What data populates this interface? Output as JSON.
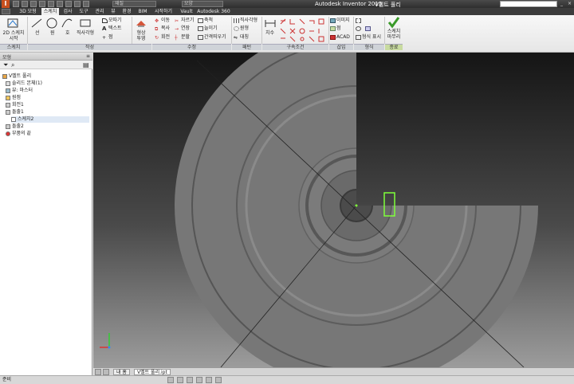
{
  "app": {
    "title": "Autodesk Inventor 2015",
    "document": "V벨트 풀리"
  },
  "quick_access": {
    "combo1": "재질",
    "combo2": "모양"
  },
  "tabs": [
    "3D 모형",
    "스케치",
    "검사",
    "도구",
    "관리",
    "뷰",
    "환경",
    "BIM",
    "시작하기",
    "Vault",
    "Autodesk 360"
  ],
  "active_tab": "스케치",
  "ribbon": {
    "sketch_2d": "2D 스케치\n시작",
    "line": "선",
    "circle": "원",
    "arc": "호",
    "rectangle": "직사각형",
    "fillet": "모따기",
    "text": "텍스트",
    "point": "점",
    "project_geometry": "형상\n투영",
    "move": "이동",
    "copy": "복사",
    "rotate": "회전",
    "trim": "자르기",
    "extend": "연장",
    "split": "분할",
    "scale": "축척",
    "stretch": "늘이기",
    "offset": "간격띄우기",
    "rect_pattern": "직사각형",
    "circ_pattern": "원형",
    "mirror": "대칭",
    "dimension": "치수",
    "image": "이미지",
    "points": "점",
    "acad": "ACAD",
    "show_format": "형식 표시",
    "finish_sketch": "스케치\n마무리"
  },
  "panels": {
    "sketch": "스케치",
    "create": "작성",
    "modify": "수정",
    "pattern": "패턴",
    "constrain": "구속조건",
    "insert": "삽입",
    "format": "형식",
    "exit": "종료"
  },
  "browser": {
    "title": "모형",
    "items": [
      {
        "label": "V벨트 풀리",
        "indent": 0
      },
      {
        "label": "솔리드 본체(1)",
        "indent": 1
      },
      {
        "label": "뷰: 마스터",
        "indent": 1
      },
      {
        "label": "원점",
        "indent": 1
      },
      {
        "label": "회전1",
        "indent": 1
      },
      {
        "label": "돌출1",
        "indent": 1
      },
      {
        "label": "스케치2",
        "indent": 2,
        "selected": true
      },
      {
        "label": "돌출2",
        "indent": 1
      },
      {
        "label": "부품의 끝",
        "indent": 1
      }
    ]
  },
  "document_tabs": {
    "home": "내 홈",
    "doc": "V벨트 풀리.ipt"
  },
  "status": "준비",
  "colors": {
    "accent": "#3a9a2a",
    "sketch_highlight": "#7fff3a",
    "titlebar": "#3c3c3c"
  }
}
